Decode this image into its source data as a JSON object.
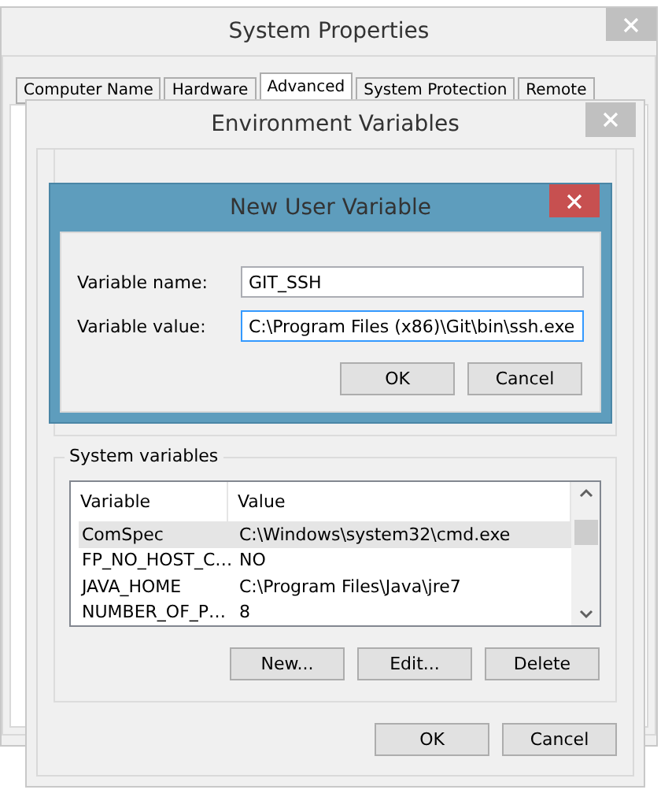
{
  "system_properties": {
    "title": "System Properties",
    "tabs": [
      {
        "label": "Computer Name",
        "selected": false
      },
      {
        "label": "Hardware",
        "selected": false
      },
      {
        "label": "Advanced",
        "selected": true
      },
      {
        "label": "System Protection",
        "selected": false
      },
      {
        "label": "Remote",
        "selected": false
      }
    ]
  },
  "environment_variables": {
    "title": "Environment Variables",
    "system_variables": {
      "title": "System variables",
      "columns": [
        "Variable",
        "Value"
      ],
      "rows": [
        {
          "variable": "ComSpec",
          "value": "C:\\Windows\\system32\\cmd.exe",
          "selected": true
        },
        {
          "variable": "FP_NO_HOST_C…",
          "value": "NO",
          "selected": false
        },
        {
          "variable": "JAVA_HOME",
          "value": "C:\\Program Files\\Java\\jre7",
          "selected": false
        },
        {
          "variable": "NUMBER_OF_P…",
          "value": "8",
          "selected": false
        }
      ],
      "buttons": [
        "New...",
        "Edit...",
        "Delete"
      ]
    },
    "buttons": [
      "OK",
      "Cancel"
    ]
  },
  "new_user_variable": {
    "title": "New User Variable",
    "fields": [
      {
        "label": "Variable name:",
        "value": "GIT_SSH",
        "focused": false
      },
      {
        "label": "Variable value:",
        "value": "C:\\Program Files (x86)\\Git\\bin\\ssh.exe",
        "focused": true
      }
    ],
    "buttons": [
      "OK",
      "Cancel"
    ]
  }
}
